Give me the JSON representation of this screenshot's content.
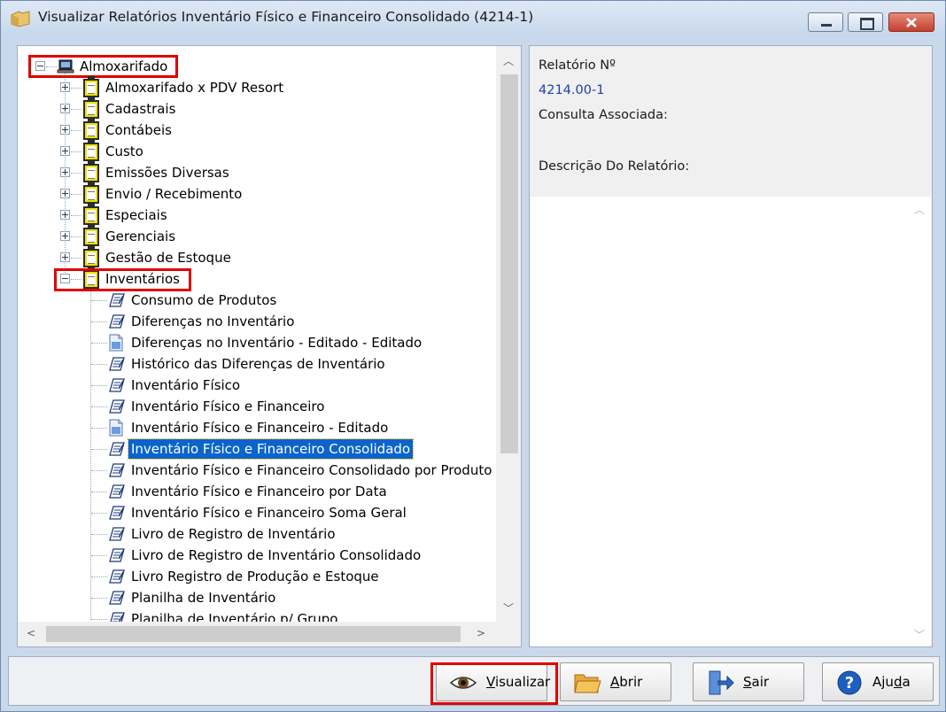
{
  "window": {
    "title": "Visualizar Relatórios Inventário Físico e Financeiro Consolidado (4214-1)"
  },
  "tree": {
    "root": "Almoxarifado",
    "folders": [
      "Almoxarifado x PDV Resort",
      "Cadastrais",
      "Contábeis",
      "Custo",
      "Emissões Diversas",
      "Envio / Recebimento",
      "Especiais",
      "Gerenciais",
      "Gestão de Estoque"
    ],
    "expanded_folder": "Inventários",
    "reports": [
      {
        "label": "Consumo de Produtos",
        "icon": "report-icon"
      },
      {
        "label": "Diferenças no Inventário",
        "icon": "report-icon"
      },
      {
        "label": "Diferenças no Inventário - Editado - Editado",
        "icon": "edited-doc-icon"
      },
      {
        "label": "Histórico das Diferenças de Inventário",
        "icon": "report-icon"
      },
      {
        "label": "Inventário Físico",
        "icon": "report-icon"
      },
      {
        "label": "Inventário Físico e Financeiro",
        "icon": "report-icon"
      },
      {
        "label": "Inventário Físico e Financeiro - Editado",
        "icon": "edited-doc-icon"
      },
      {
        "label": "Inventário Físico e Financeiro Consolidado",
        "icon": "report-icon",
        "selected": true
      },
      {
        "label": "Inventário Físico e Financeiro Consolidado por Produto",
        "icon": "report-icon"
      },
      {
        "label": "Inventário Físico e Financeiro por Data",
        "icon": "report-icon"
      },
      {
        "label": "Inventário Físico e Financeiro Soma Geral",
        "icon": "report-icon"
      },
      {
        "label": "Livro de Registro de Inventário",
        "icon": "report-icon"
      },
      {
        "label": "Livro de Registro de Inventário Consolidado",
        "icon": "report-icon"
      },
      {
        "label": "Livro Registro de Produção e Estoque",
        "icon": "report-icon"
      },
      {
        "label": "Planilha de Inventário",
        "icon": "report-icon"
      },
      {
        "label": "Planilha de Inventário p/ Grupo",
        "icon": "report-icon"
      }
    ]
  },
  "info": {
    "report_number_label": "Relatório Nº",
    "report_number_value": "4214.00-1",
    "associated_query_label": "Consulta Associada:",
    "description_label": "Descrição Do Relatório:"
  },
  "buttons": {
    "visualizar": {
      "pre": "",
      "key": "V",
      "post": "isualizar"
    },
    "abrir": {
      "pre": "",
      "key": "A",
      "post": "brir"
    },
    "sair": {
      "pre": "",
      "key": "S",
      "post": "air"
    },
    "ajuda": {
      "pre": "Aju",
      "key": "d",
      "post": "a"
    }
  },
  "colors": {
    "selection": "#0a64cc",
    "highlight": "#e00000",
    "info_value": "#1f3faa"
  }
}
